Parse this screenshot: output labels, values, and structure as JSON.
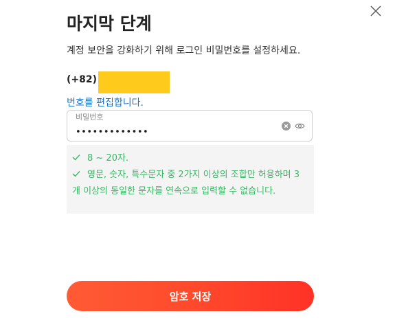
{
  "dialog": {
    "title": "마지막 단계",
    "description": "계정 보안을 강화하기 위해 로그인 비밀번호를 설정하세요.",
    "phone_code": "(+82)",
    "edit_link": "번호를 편집합니다.",
    "close_icon": "close-icon"
  },
  "password": {
    "label": "비밀번호",
    "value": "•••••••••••••",
    "clear_icon": "clear-icon",
    "eye_icon": "eye-icon"
  },
  "rules": [
    "8 ~ 20자.",
    "영문, 숫자, 특수문자 중 2가지 이상의 조합만 허용하며 3개 이상의 동일한 문자를 연속으로 입력할 수 없습니다."
  ],
  "save_button": "암호 저장",
  "colors": {
    "accent_start": "#ff5b35",
    "accent_end": "#ff3226",
    "link": "#1a73c9",
    "rule_ok": "#36b864",
    "mask": "#fecb1c"
  }
}
